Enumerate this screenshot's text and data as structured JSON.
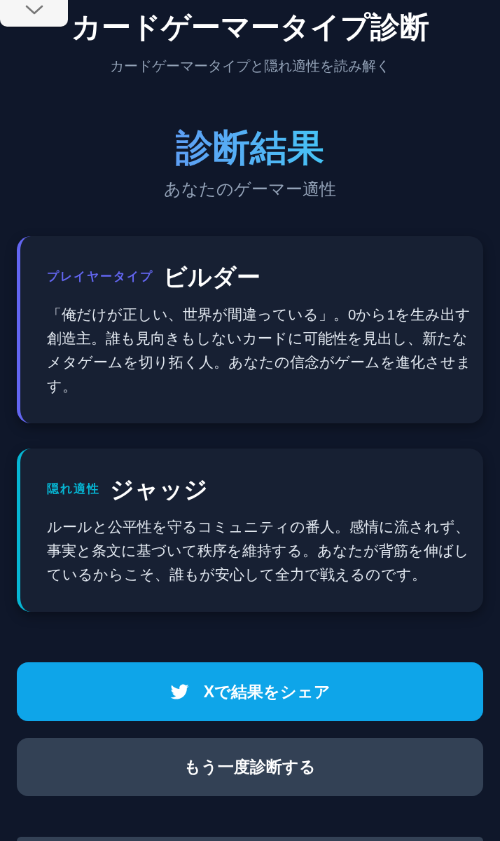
{
  "header": {
    "title": "カードゲーマータイプ診断",
    "subtitle": "カードゲーマータイプと隠れ適性を読み解く"
  },
  "result": {
    "heading": "診断結果",
    "subheading": "あなたのゲーマー適性"
  },
  "cards": [
    {
      "label": "プレイヤータイプ",
      "name": "ビルダー",
      "description": "「俺だけが正しい、世界が間違っている」。0から1を生み出す創造主。誰も見向きもしないカードに可能性を見出し、新たなメタゲームを切り拓く人。あなたの信念がゲームを進化させます。",
      "color": "#6366f1"
    },
    {
      "label": "隠れ適性",
      "name": "ジャッジ",
      "description": "ルールと公平性を守るコミュニティの番人。感情に流されず、事実と条文に基づいて秩序を維持する。あなたが背筋を伸ばしているからこそ、誰もが安心して全力で戦えるのです。",
      "color": "#06b6d4"
    }
  ],
  "buttons": [
    {
      "kind": "share",
      "label": "Xで結果をシェア"
    },
    {
      "kind": "retry",
      "label": "もう一度診断する"
    }
  ]
}
